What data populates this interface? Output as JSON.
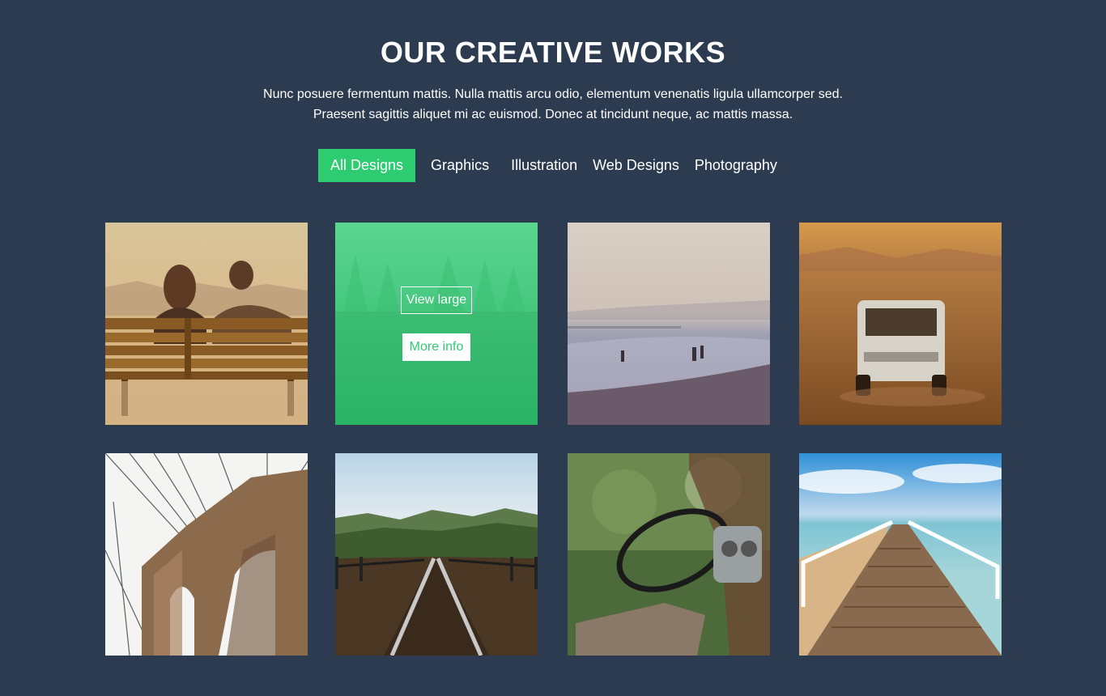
{
  "header": {
    "title": "OUR CREATIVE WORKS",
    "description_line1": "Nunc posuere fermentum mattis. Nulla mattis arcu odio, elementum venenatis ligula ullamcorper sed.",
    "description_line2": "Praesent sagittis aliquet mi ac euismod. Donec at tincidunt neque, ac mattis massa."
  },
  "filters": {
    "active_index": 0,
    "items": [
      "All Designs",
      "Graphics",
      "Illustration",
      "Web Designs",
      "Photography"
    ]
  },
  "overlay": {
    "view_label": "View large",
    "more_label": "More info"
  },
  "colors": {
    "background": "#2c3b4f",
    "accent": "#2ecc71",
    "text": "#ffffff"
  },
  "portfolio": {
    "items": [
      {
        "subject": "couple on bench"
      },
      {
        "subject": "forest",
        "hovered": true
      },
      {
        "subject": "beach swimmers"
      },
      {
        "subject": "van in desert"
      },
      {
        "subject": "bridge tower"
      },
      {
        "subject": "railway tracks"
      },
      {
        "subject": "abandoned car interior"
      },
      {
        "subject": "wooden pier"
      }
    ]
  }
}
